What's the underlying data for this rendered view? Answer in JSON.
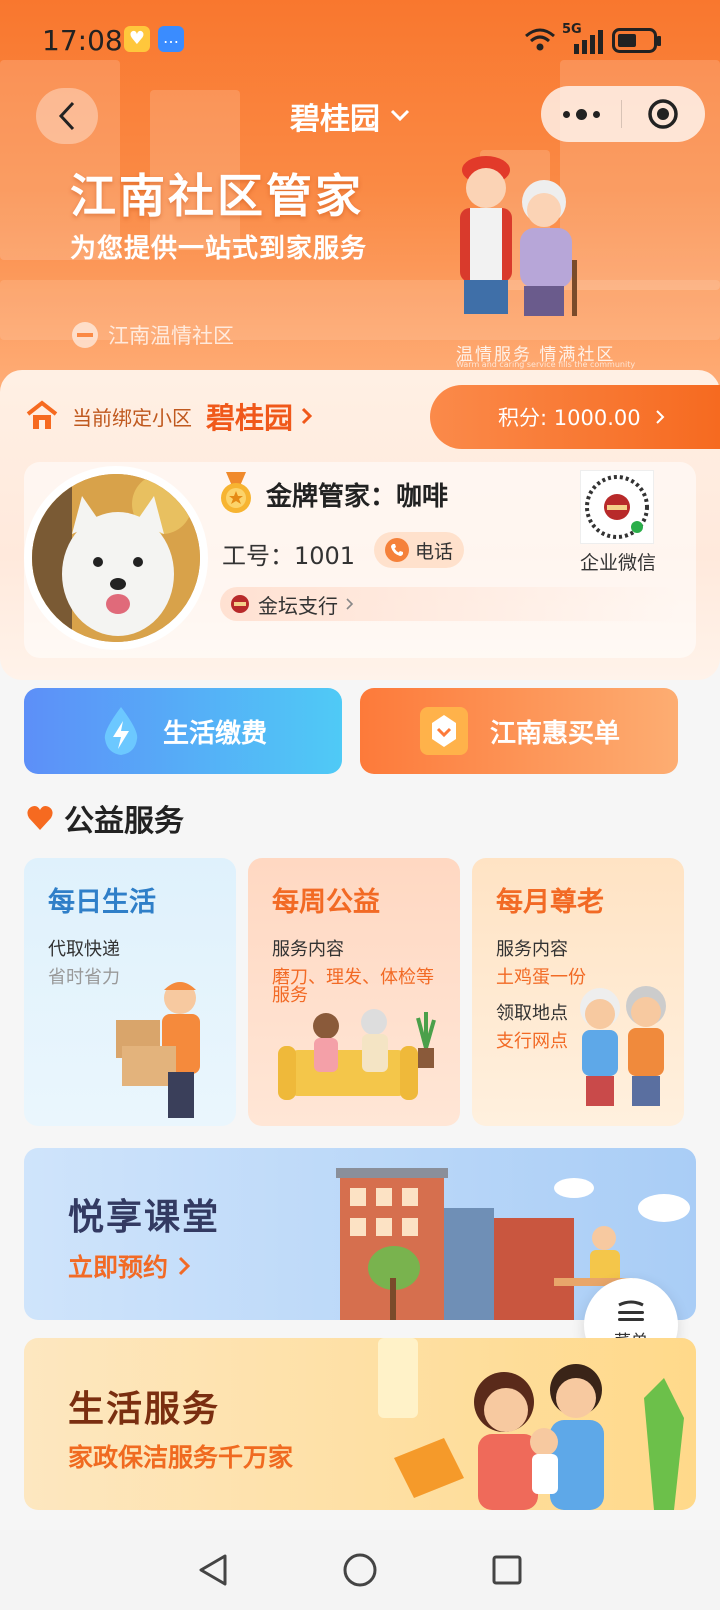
{
  "status_bar": {
    "time": "17:08",
    "network": "5G"
  },
  "header": {
    "community_dropdown": "碧桂园"
  },
  "hero": {
    "title": "江南社区管家",
    "subtitle": "为您提供一站式到家服务",
    "brand": "江南温情社区",
    "slogan": "温情服务 情满社区",
    "slogan_en": "Warm and caring service fills the community"
  },
  "binding": {
    "label": "当前绑定小区",
    "community": "碧桂园"
  },
  "points": {
    "text": "积分: 1000.00"
  },
  "steward": {
    "title": "金牌管家：咖啡",
    "id_text": "工号：1001",
    "phone_label": "电话",
    "branch": "金坛支行",
    "wechat_label": "企业微信"
  },
  "actions": {
    "pay_label": "生活缴费",
    "buy_label": "江南惠买单"
  },
  "section": {
    "title": "公益服务"
  },
  "services": [
    {
      "title": "每日生活",
      "line1": "代取快递",
      "line2": "省时省力"
    },
    {
      "title": "每周公益",
      "line1": "服务内容",
      "line2": "磨刀、理发、体检等服务"
    },
    {
      "title": "每月尊老",
      "line1": "服务内容",
      "line2": "土鸡蛋一份",
      "line3": "领取地点",
      "line4": "支行网点"
    }
  ],
  "classroom": {
    "title": "悦享课堂",
    "cta": "立即预约"
  },
  "menu_button": {
    "label": "菜单"
  },
  "life": {
    "title": "生活服务",
    "subtitle": "家政保洁服务千万家"
  },
  "colors": {
    "brand_orange": "#f66a20",
    "blue": "#5a9cf6",
    "text_blue": "#2f7fc8"
  }
}
